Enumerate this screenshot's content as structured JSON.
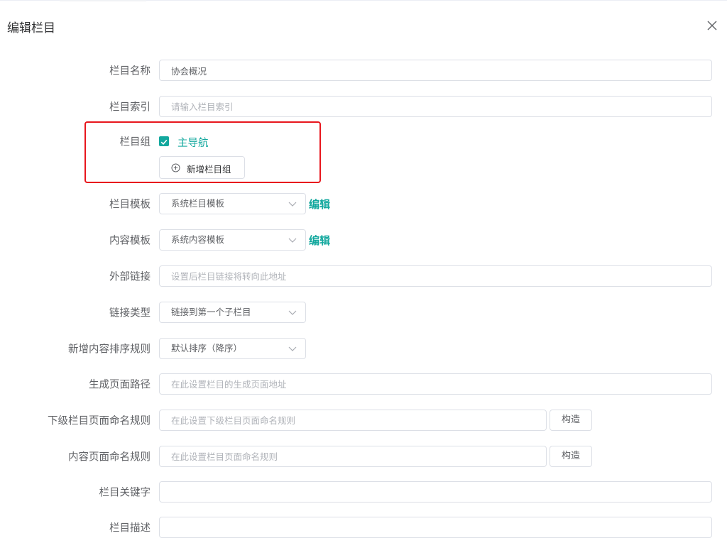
{
  "dialog": {
    "title": "编辑栏目"
  },
  "form": {
    "name": {
      "label": "栏目名称",
      "value": "协会概况"
    },
    "index": {
      "label": "栏目索引",
      "placeholder": "请输入栏目索引"
    },
    "group": {
      "label": "栏目组",
      "checkbox_label": "主导航",
      "checked": true,
      "add_button": "新增栏目组"
    },
    "template": {
      "label": "栏目模板",
      "selected": "系统栏目模板",
      "edit": "编辑"
    },
    "content_template": {
      "label": "内容模板",
      "selected": "系统内容模板",
      "edit": "编辑"
    },
    "external_link": {
      "label": "外部链接",
      "placeholder": "设置后栏目链接将转向此地址"
    },
    "link_type": {
      "label": "链接类型",
      "selected": "链接到第一个子栏目"
    },
    "sort_rule": {
      "label": "新增内容排序规则",
      "selected": "默认排序（降序）"
    },
    "page_path": {
      "label": "生成页面路径",
      "placeholder": "在此设置栏目的生成页面地址"
    },
    "child_naming": {
      "label": "下级栏目页面命名规则",
      "placeholder": "在此设置下级栏目页面命名规则",
      "button": "构造"
    },
    "content_naming": {
      "label": "内容页面命名规则",
      "placeholder": "在此设置栏目页面命名规则",
      "button": "构造"
    },
    "keywords": {
      "label": "栏目关键字",
      "value": ""
    },
    "description": {
      "label": "栏目描述"
    }
  },
  "colors": {
    "accent": "#13a89e",
    "highlight_border": "#e8161d",
    "border": "#dcdfe6",
    "label": "#606266"
  },
  "icons": {
    "close": "close-icon",
    "check": "check-icon",
    "add": "plus-circle-icon",
    "dropdown": "chevron-down-icon"
  }
}
